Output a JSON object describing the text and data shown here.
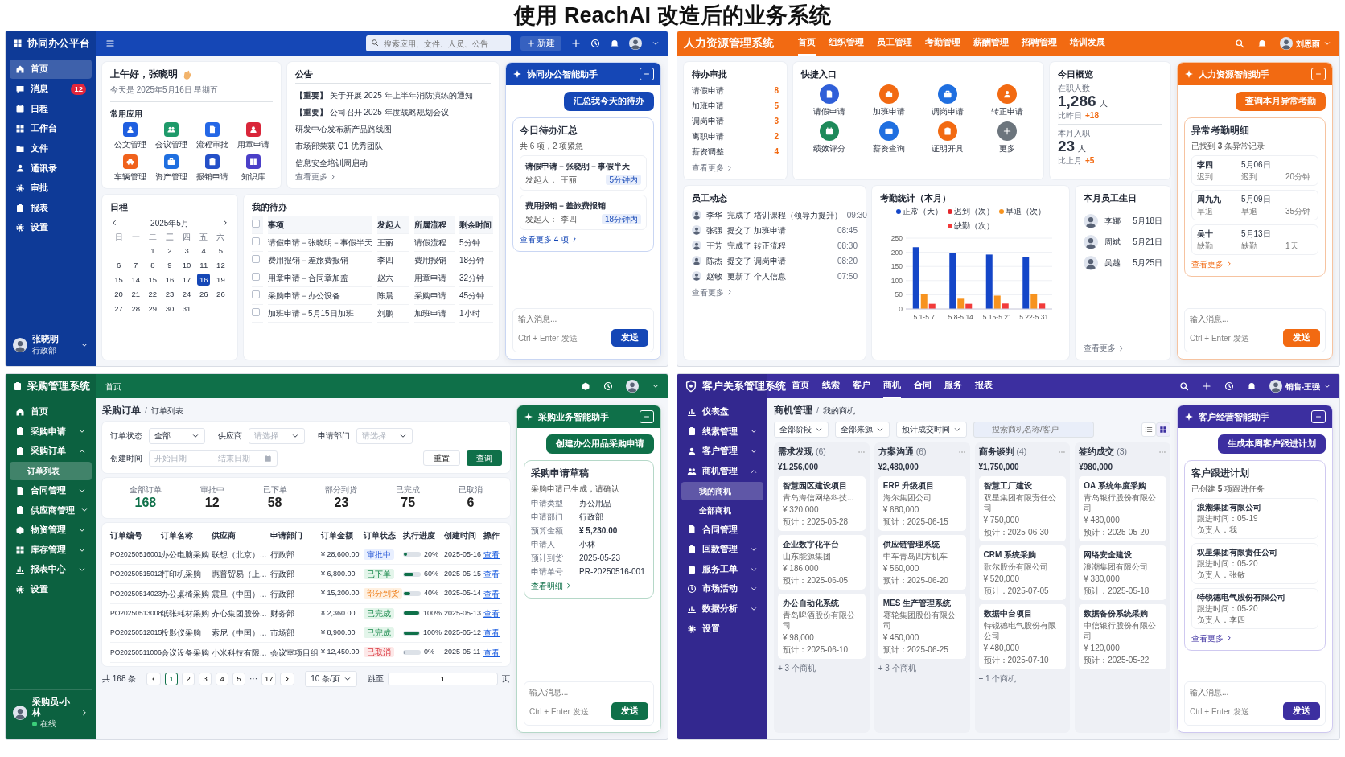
{
  "title": "使用 ReachAI 改造后的业务系统",
  "office": {
    "brand": "协同办公平台",
    "search": {
      "placeholder": "搜索应用、文件、人员、公告"
    },
    "new_button": "新建",
    "sidebar": [
      {
        "label": "首页",
        "selected": true
      },
      {
        "label": "消息",
        "selected": false,
        "badge": "12"
      },
      {
        "label": "日程",
        "selected": false
      },
      {
        "label": "工作台",
        "selected": false
      },
      {
        "label": "文件",
        "selected": false
      },
      {
        "label": "通讯录",
        "selected": false
      },
      {
        "label": "审批",
        "selected": false
      },
      {
        "label": "报表",
        "selected": false
      },
      {
        "label": "设置",
        "selected": false
      }
    ],
    "user": {
      "name": "张晓明",
      "dept": "行政部"
    },
    "greeting": {
      "title": "上午好，张晓明",
      "date": "今天是 2025年5月16日 星期五",
      "apps_title": "常用应用",
      "apps": [
        {
          "label": "公文管理",
          "color": "#1f5fe0"
        },
        {
          "label": "会议管理",
          "color": "#1e9a6a"
        },
        {
          "label": "流程审批",
          "color": "#2467e6"
        },
        {
          "label": "用章申请",
          "color": "#d9263a"
        },
        {
          "label": "车辆管理",
          "color": "#f0621c"
        },
        {
          "label": "资产管理",
          "color": "#1f6fe0"
        },
        {
          "label": "报销申请",
          "color": "#2450c8"
        },
        {
          "label": "知识库",
          "color": "#4b3fc8"
        }
      ]
    },
    "notices": {
      "title": "公告",
      "items": [
        "**【重要】** 关于开展 2025 年上半年消防演练的通知",
        "**【重要】** 公司召开 2025 年度战略规划会议",
        "研发中心发布新产品路线图",
        "市场部荣获 Q1 优秀团队",
        "信息安全培训周启动"
      ],
      "more": "查看更多"
    },
    "calendar": {
      "title": "日程",
      "month": "2025年5月",
      "weekdays": [
        "日",
        "一",
        "二",
        "三",
        "四",
        "五",
        "六"
      ],
      "weeks": [
        [
          {
            "day": "1",
            "selected": false
          },
          {
            "day": "2",
            "selected": false
          },
          {
            "day": "3",
            "selected": false
          },
          {
            "day": "4",
            "selected": false
          },
          {
            "day": "5",
            "selected": false
          }
        ],
        [
          {
            "day": "6",
            "selected": false
          },
          {
            "day": "7",
            "selected": false
          },
          {
            "day": "8",
            "selected": false
          },
          {
            "day": "9",
            "selected": false
          },
          {
            "day": "10",
            "selected": false
          },
          {
            "day": "11",
            "selected": false
          },
          {
            "day": "12",
            "selected": false
          }
        ],
        [
          {
            "day": "15",
            "selected": false
          },
          {
            "day": "14",
            "selected": false
          },
          {
            "day": "15",
            "selected": false
          },
          {
            "day": "16",
            "selected": false
          },
          {
            "day": "17",
            "selected": false
          },
          {
            "day": "16",
            "selected": true
          },
          {
            "day": "19",
            "selected": false
          }
        ],
        [
          {
            "day": "20",
            "selected": false
          },
          {
            "day": "21",
            "selected": false
          },
          {
            "day": "22",
            "selected": false
          },
          {
            "day": "23",
            "selected": false
          },
          {
            "day": "24",
            "selected": false
          },
          {
            "day": "26",
            "selected": false
          },
          {
            "day": "26",
            "selected": false
          }
        ],
        [
          {
            "day": "27",
            "selected": false
          },
          {
            "day": "28",
            "selected": false
          },
          {
            "day": "29",
            "selected": false
          },
          {
            "day": "30",
            "selected": false
          },
          {
            "day": "31",
            "selected": false
          }
        ]
      ]
    },
    "todo": {
      "title": "我的待办",
      "columns": [
        "事项",
        "发起人",
        "所属流程",
        "剩余时间"
      ],
      "header_checked": false,
      "rows": [
        {
          "checked": false,
          "cells": [
            "请假申请－张晓明－事假半天",
            "王丽",
            "请假流程",
            "5分钟"
          ]
        },
        {
          "checked": false,
          "cells": [
            "费用报销－差旅费报销",
            "李四",
            "费用报销",
            "18分钟"
          ]
        },
        {
          "checked": false,
          "cells": [
            "用章申请－合同章加盖",
            "赵六",
            "用章申请",
            "32分钟"
          ]
        },
        {
          "checked": false,
          "cells": [
            "采购申请－办公设备",
            "陈晨",
            "采购申请",
            "45分钟"
          ]
        },
        {
          "checked": false,
          "cells": [
            "加班申请－5月15日加班",
            "刘鹏",
            "加班申请",
            "1小时"
          ]
        }
      ]
    },
    "assistant": {
      "title": "协同办公智能助手",
      "action": "汇总我今天的待办",
      "card": {
        "title": "今日待办汇总",
        "subtitle": "共 6 项，2 项紧急",
        "items": [
          {
            "title": "请假申请－张晓明－事假半天",
            "label": "发起人：",
            "value": "王丽",
            "tag": "5分钟内"
          },
          {
            "title": "费用报销－差旅费报销",
            "label": "发起人：",
            "value": "李四",
            "tag": "18分钟内"
          }
        ]
      },
      "more": "查看更多 4 项",
      "placeholder": "输入消息...",
      "hint": "Ctrl + Enter 发送",
      "send": "发送"
    }
  },
  "hr": {
    "brand": "人力资源管理系统",
    "nav": [
      {
        "label": "首页",
        "selected": true
      },
      {
        "label": "组织管理",
        "selected": false
      },
      {
        "label": "员工管理",
        "selected": false
      },
      {
        "label": "考勤管理",
        "selected": false
      },
      {
        "label": "薪酬管理",
        "selected": false
      },
      {
        "label": "招聘管理",
        "selected": false
      },
      {
        "label": "培训发展",
        "selected": false
      }
    ],
    "user": "刘思雨",
    "approvals": {
      "title": "待办审批",
      "items": [
        {
          "label": "请假申请",
          "count": "8"
        },
        {
          "label": "加班申请",
          "count": "5"
        },
        {
          "label": "调岗申请",
          "count": "3"
        },
        {
          "label": "离职申请",
          "count": "2"
        },
        {
          "label": "薪资调整",
          "count": "4"
        }
      ],
      "more": "查看更多"
    },
    "quick": {
      "title": "快捷入口",
      "items": [
        {
          "label": "请假申请",
          "color": "#2f5fd8"
        },
        {
          "label": "加班申请",
          "color": "#f26a12"
        },
        {
          "label": "调岗申请",
          "color": "#1f6fe0"
        },
        {
          "label": "转正申请",
          "color": "#f26a12"
        },
        {
          "label": "绩效评分",
          "color": "#1e8a5a"
        },
        {
          "label": "薪资查询",
          "color": "#1f6fe0"
        },
        {
          "label": "证明开具",
          "color": "#f26a12"
        },
        {
          "label": "更多",
          "color": "#6c757d"
        }
      ]
    },
    "overview": {
      "title": "今日概览",
      "stats": [
        {
          "label": "在职人数",
          "value": "1,286",
          "unit": "人",
          "compare": "比昨日",
          "delta": "+18"
        },
        {
          "label": "本月入职",
          "value": "23",
          "unit": "人",
          "compare": "比上月",
          "delta": "+5"
        }
      ]
    },
    "activity": {
      "title": "员工动态",
      "items": [
        {
          "name": "李华",
          "action": "完成了 培训课程（领导力提升）",
          "time": "09:30"
        },
        {
          "name": "张强",
          "action": "提交了 加班申请",
          "time": "08:45"
        },
        {
          "name": "王芳",
          "action": "完成了 转正流程",
          "time": "08:30"
        },
        {
          "name": "陈杰",
          "action": "提交了 调岗申请",
          "time": "08:20"
        },
        {
          "name": "赵敏",
          "action": "更新了 个人信息",
          "time": "07:50"
        }
      ],
      "more": "查看更多"
    },
    "attendance": {
      "title": "考勤统计（本月）",
      "chart_data": {
        "type": "bar",
        "categories": [
          "5.1-5.7",
          "5.8-5.14",
          "5.15-5.21",
          "5.22-5.31"
        ],
        "series": [
          {
            "name": "正常（天）",
            "color": "#1446c8",
            "values": [
              218,
              198,
              192,
              184
            ]
          },
          {
            "name": "迟到（次）",
            "color": "#e3262b",
            "values": [
              null,
              null,
              null,
              null
            ]
          },
          {
            "name": "早退（次）",
            "color": "#f7931e",
            "values": [
              52,
              36,
              47,
              54
            ]
          },
          {
            "name": "缺勤（次）",
            "color": "#f23a3a",
            "values": [
              18,
              18,
              19,
              19
            ]
          }
        ],
        "ylim": [
          0,
          250
        ],
        "yticks": [
          0,
          50,
          100,
          150,
          200,
          250
        ],
        "grid": true
      }
    },
    "birthdays": {
      "title": "本月员工生日",
      "items": [
        {
          "name": "李娜",
          "date": "5月18日"
        },
        {
          "name": "周斌",
          "date": "5月21日"
        },
        {
          "name": "吴越",
          "date": "5月25日"
        }
      ],
      "more": "查看更多"
    },
    "assistant": {
      "title": "人力资源智能助手",
      "action": "查询本月异常考勤",
      "card": {
        "title": "异常考勤明细",
        "subtitle": "已找到 **3** 条异常记录",
        "items": [
          {
            "name": "李四",
            "date": "5月06日",
            "type": "迟到",
            "status": "迟到",
            "duration": "20分钟"
          },
          {
            "name": "周九九",
            "date": "5月09日",
            "type": "早退",
            "status": "早退",
            "duration": "35分钟"
          },
          {
            "name": "吴十",
            "date": "5月13日",
            "type": "缺勤",
            "status": "缺勤",
            "duration": "1天"
          }
        ]
      },
      "more": "查看更多",
      "placeholder": "输入消息...",
      "hint": "Ctrl + Enter 发送",
      "send": "发送"
    }
  },
  "purchase": {
    "brand": "采购管理系统",
    "crumb": "首页",
    "sidebar": [
      {
        "label": "首页",
        "selected": false
      },
      {
        "label": "采购申请",
        "selected": false,
        "expanded": false
      },
      {
        "label": "采购订单",
        "selected": false,
        "expanded": true,
        "children": [
          {
            "label": "订单列表",
            "selected": true
          }
        ]
      },
      {
        "label": "合同管理",
        "selected": false,
        "expanded": false
      },
      {
        "label": "供应商管理",
        "selected": false,
        "expanded": false
      },
      {
        "label": "物资管理",
        "selected": false,
        "expanded": false
      },
      {
        "label": "库存管理",
        "selected": false,
        "expanded": false
      },
      {
        "label": "报表中心",
        "selected": false,
        "expanded": false
      },
      {
        "label": "设置",
        "selected": false
      }
    ],
    "user": {
      "name": "采购员-小林",
      "status": "在线"
    },
    "breadcrumb": [
      "采购订单",
      "订单列表"
    ],
    "breadcrumb_separator": "/",
    "filters": [
      {
        "label": "订单状态",
        "value": "全部"
      },
      {
        "label": "供应商",
        "placeholder": "请选择"
      },
      {
        "label": "申请部门",
        "placeholder": "请选择"
      }
    ],
    "date_filter": {
      "label": "创建时间",
      "start": "开始日期",
      "separator": "–",
      "end": "结束日期"
    },
    "reset": "重置",
    "query": "查询",
    "stats": [
      {
        "label": "全部订单",
        "value": "168",
        "selected": true
      },
      {
        "label": "审批中",
        "value": "12",
        "selected": false
      },
      {
        "label": "已下单",
        "value": "58",
        "selected": false
      },
      {
        "label": "部分到货",
        "value": "23",
        "selected": false
      },
      {
        "label": "已完成",
        "value": "75",
        "selected": false
      },
      {
        "label": "已取消",
        "value": "6",
        "selected": false
      }
    ],
    "columns": [
      "订单编号",
      "订单名称",
      "供应商",
      "申请部门",
      "订单金额",
      "订单状态",
      "执行进度",
      "创建时间",
      "操作"
    ],
    "rows": [
      {
        "id": "PO20250516001",
        "name": "办公电脑采购",
        "supplier": "联想（北京）...",
        "dept": "行政部",
        "amount": "¥ 28,600.00",
        "status": "审批中",
        "kind": "pending",
        "level": 0.2,
        "progress": "20%",
        "date": "2025-05-16",
        "action": "查看"
      },
      {
        "id": "PO20250515012",
        "name": "打印机采购",
        "supplier": "惠普贸易（上...",
        "dept": "行政部",
        "amount": "¥ 6,800.00",
        "status": "已下单",
        "kind": "ordered",
        "level": 0.6,
        "progress": "60%",
        "date": "2025-05-15",
        "action": "查看"
      },
      {
        "id": "PO20250514023",
        "name": "办公桌椅采购",
        "supplier": "震旦（中国）...",
        "dept": "行政部",
        "amount": "¥ 15,200.00",
        "status": "部分到货",
        "kind": "partial",
        "level": 0.4,
        "progress": "40%",
        "date": "2025-05-14",
        "action": "查看"
      },
      {
        "id": "PO20250513008",
        "name": "纸张耗材采购",
        "supplier": "齐心集团股份...",
        "dept": "财务部",
        "amount": "¥ 2,360.00",
        "status": "已完成",
        "kind": "done",
        "level": 1,
        "progress": "100%",
        "date": "2025-05-13",
        "action": "查看"
      },
      {
        "id": "PO20250512015",
        "name": "投影仪采购",
        "supplier": "索尼（中国）...",
        "dept": "市场部",
        "amount": "¥ 8,900.00",
        "status": "已完成",
        "kind": "done",
        "level": 1,
        "progress": "100%",
        "date": "2025-05-12",
        "action": "查看"
      },
      {
        "id": "PO20250511006",
        "name": "会议设备采购",
        "supplier": "小米科技有限...",
        "dept": "会议室项目组",
        "amount": "¥ 12,450.00",
        "status": "已取消",
        "kind": "cancelled",
        "level": 0,
        "progress": "0%",
        "date": "2025-05-11",
        "action": "查看"
      }
    ],
    "pagination": {
      "total": "共 168 条",
      "pages": [
        {
          "label": "1",
          "selected": true
        },
        {
          "label": "2",
          "selected": false
        },
        {
          "label": "3",
          "selected": false
        },
        {
          "label": "4",
          "selected": false
        },
        {
          "label": "5",
          "selected": false
        },
        {
          "label": "17",
          "selected": false
        }
      ],
      "ellipsis": "···",
      "page_size": "10 条/页",
      "jump": "跳至",
      "jump_value": "1",
      "page_unit": "页"
    },
    "assistant": {
      "title": "采购业务智能助手",
      "action": "创建办公用品采购申请",
      "card": {
        "title": "采购申请草稿",
        "subtitle": "采购申请已生成，请确认",
        "items": [
          {
            "label": "申请类型",
            "value": "办公用品"
          },
          {
            "label": "申请部门",
            "value": "行政部"
          },
          {
            "label": "预算金额",
            "value": "¥ 5,230.00"
          },
          {
            "label": "申请人",
            "value": "小林"
          },
          {
            "label": "预计到货",
            "value": "2025-05-23"
          },
          {
            "label": "申请单号",
            "value": "PR-20250516-001"
          }
        ]
      },
      "more": "查看明细",
      "placeholder": "输入消息...",
      "hint": "Ctrl + Enter 发送",
      "send": "发送"
    }
  },
  "crm": {
    "brand": "客户关系管理系统",
    "nav": [
      {
        "label": "首页",
        "selected": false
      },
      {
        "label": "线索",
        "selected": false
      },
      {
        "label": "客户",
        "selected": false
      },
      {
        "label": "商机",
        "selected": true
      },
      {
        "label": "合同",
        "selected": false
      },
      {
        "label": "服务",
        "selected": false
      },
      {
        "label": "报表",
        "selected": false
      }
    ],
    "user": "销售-王强",
    "sidebar": [
      {
        "label": "仪表盘",
        "selected": false
      },
      {
        "label": "线索管理",
        "selected": false,
        "expanded": false
      },
      {
        "label": "客户管理",
        "selected": false,
        "expanded": false
      },
      {
        "label": "商机管理",
        "selected": false,
        "expanded": true,
        "children": [
          {
            "label": "我的商机",
            "selected": true
          },
          {
            "label": "全部商机",
            "selected": false
          }
        ]
      },
      {
        "label": "合同管理",
        "selected": false
      },
      {
        "label": "回款管理",
        "selected": false,
        "expanded": false
      },
      {
        "label": "服务工单",
        "selected": false,
        "expanded": false
      },
      {
        "label": "市场活动",
        "selected": false,
        "expanded": false
      },
      {
        "label": "数据分析",
        "selected": false,
        "expanded": false
      },
      {
        "label": "设置",
        "selected": false
      }
    ],
    "breadcrumb": [
      "商机管理",
      "我的商机"
    ],
    "breadcrumb_separator": "/",
    "filters": [
      "全部阶段",
      "全部来源",
      "预计成交时间"
    ],
    "search": {
      "placeholder": "搜索商机名称/客户"
    },
    "view_toggle": [
      {
        "selected": false
      },
      {
        "selected": true
      }
    ],
    "columns": [
      {
        "title": "需求发现",
        "count": "(6)",
        "amount": "¥1,256,000",
        "cards": [
          {
            "name": "智慧园区建设项目",
            "company": "青岛海信网络科技...",
            "amount": "¥ 320,000",
            "date": "预计：2025-05-28"
          },
          {
            "name": "企业数字化平台",
            "company": "山东能源集团",
            "amount": "¥ 186,000",
            "date": "预计：2025-06-05"
          },
          {
            "name": "办公自动化系统",
            "company": "青岛啤酒股份有限公司",
            "amount": "¥ 98,000",
            "date": "预计：2025-06-10"
          }
        ],
        "footer": "+ 3 个商机"
      },
      {
        "title": "方案沟通",
        "count": "(6)",
        "amount": "¥2,480,000",
        "cards": [
          {
            "name": "ERP 升级项目",
            "company": "海尔集团公司",
            "amount": "¥ 680,000",
            "date": "预计：2025-06-15"
          },
          {
            "name": "供应链管理系统",
            "company": "中车青岛四方机车",
            "amount": "¥ 560,000",
            "date": "预计：2025-06-20"
          },
          {
            "name": "MES 生产管理系统",
            "company": "赛轮集团股份有限公司",
            "amount": "¥ 450,000",
            "date": "预计：2025-06-25"
          }
        ],
        "footer": "+ 3 个商机"
      },
      {
        "title": "商务谈判",
        "count": "(4)",
        "amount": "¥1,750,000",
        "cards": [
          {
            "name": "智慧工厂建设",
            "company": "双星集团有限责任公司",
            "amount": "¥ 750,000",
            "date": "预计：2025-06-30"
          },
          {
            "name": "CRM 系统采购",
            "company": "歌尔股份有限公司",
            "amount": "¥ 520,000",
            "date": "预计：2025-07-05"
          },
          {
            "name": "数据中台项目",
            "company": "特锐德电气股份有限公司",
            "amount": "¥ 480,000",
            "date": "预计：2025-07-10"
          }
        ],
        "footer": "+ 1 个商机"
      },
      {
        "title": "签约成交",
        "count": "(3)",
        "amount": "¥980,000",
        "cards": [
          {
            "name": "OA 系统年度采购",
            "company": "青岛银行股份有限公司",
            "amount": "¥ 480,000",
            "date": "预计：2025-05-20"
          },
          {
            "name": "网络安全建设",
            "company": "浪潮集团有限公司",
            "amount": "¥ 380,000",
            "date": "预计：2025-05-18"
          },
          {
            "name": "数据备份系统采购",
            "company": "中信银行股份有限公司",
            "amount": "¥ 120,000",
            "date": "预计：2025-05-22"
          }
        ]
      }
    ],
    "assistant": {
      "title": "客户经营智能助手",
      "action": "生成本周客户跟进计划",
      "card": {
        "title": "客户跟进计划",
        "subtitle": "已创建 **5** 项跟进任务",
        "items": [
          {
            "company": "浪潮集团有限公司",
            "time": "跟进时间：05-19",
            "owner": "负责人：我"
          },
          {
            "company": "双星集团有限责任公司",
            "time": "跟进时间：05-20",
            "owner": "负责人：张敏"
          },
          {
            "company": "特锐德电气股份有限公司",
            "time": "跟进时间：05-20",
            "owner": "负责人：李四"
          }
        ]
      },
      "more": "查看更多",
      "placeholder": "输入消息...",
      "hint": "Ctrl + Enter 发送",
      "send": "发送"
    }
  }
}
